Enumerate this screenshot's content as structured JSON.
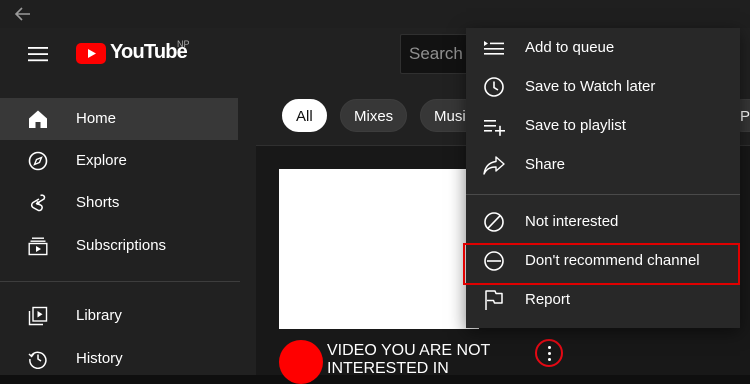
{
  "header": {
    "brand": "YouTube",
    "country_code": "NP",
    "search_placeholder": "Search"
  },
  "sidebar": {
    "items": [
      {
        "label": "Home",
        "icon": "home-icon",
        "active": true
      },
      {
        "label": "Explore",
        "icon": "compass-icon"
      },
      {
        "label": "Shorts",
        "icon": "shorts-icon"
      },
      {
        "label": "Subscriptions",
        "icon": "subscriptions-icon"
      },
      {
        "label": "Library",
        "icon": "library-icon"
      },
      {
        "label": "History",
        "icon": "history-icon"
      }
    ]
  },
  "chips": [
    {
      "label": "All",
      "active": true
    },
    {
      "label": "Mixes"
    },
    {
      "label": "Music"
    },
    {
      "label": "Podcasts"
    }
  ],
  "video": {
    "title": "VIDEO YOU ARE NOT INTERESTED IN"
  },
  "menu": {
    "items": [
      {
        "label": "Add to queue",
        "icon": "add-to-queue-icon"
      },
      {
        "label": "Save to Watch later",
        "icon": "clock-icon"
      },
      {
        "label": "Save to playlist",
        "icon": "playlist-add-icon"
      },
      {
        "label": "Share",
        "icon": "share-icon"
      },
      {
        "label": "Not interested",
        "icon": "not-interested-icon"
      },
      {
        "label": "Don't recommend channel",
        "icon": "minus-circle-icon",
        "highlighted": true
      },
      {
        "label": "Report",
        "icon": "flag-icon"
      }
    ]
  },
  "colors": {
    "brand_red": "#ff0000",
    "highlight_red": "#e00000",
    "background": "#0f0f0f"
  }
}
